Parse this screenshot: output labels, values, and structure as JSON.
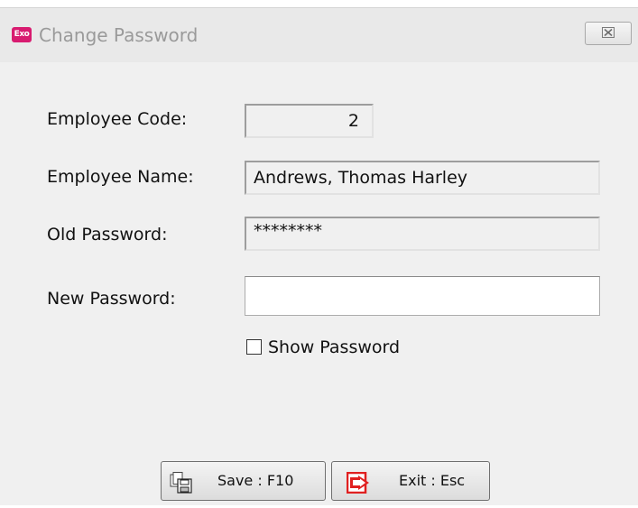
{
  "window": {
    "app_icon_text": "Exo",
    "title": "Change Password",
    "close_symbol": "☒"
  },
  "form": {
    "employee_code_label": "Employee Code:",
    "employee_code_value": "2",
    "employee_name_label": "Employee Name:",
    "employee_name_value": "Andrews, Thomas Harley",
    "old_password_label": "Old Password:",
    "old_password_value": "********",
    "new_password_label": "New Password:",
    "new_password_value": "",
    "show_password_label": "Show Password",
    "show_password_checked": false
  },
  "buttons": {
    "save_label": "Save : F10",
    "exit_label": "Exit : Esc",
    "save_icon": "floppy-disk-icon",
    "exit_icon": "exit-door-icon"
  },
  "colors": {
    "exo_brand": "#d81b70",
    "exit_icon_red": "#e02020"
  }
}
